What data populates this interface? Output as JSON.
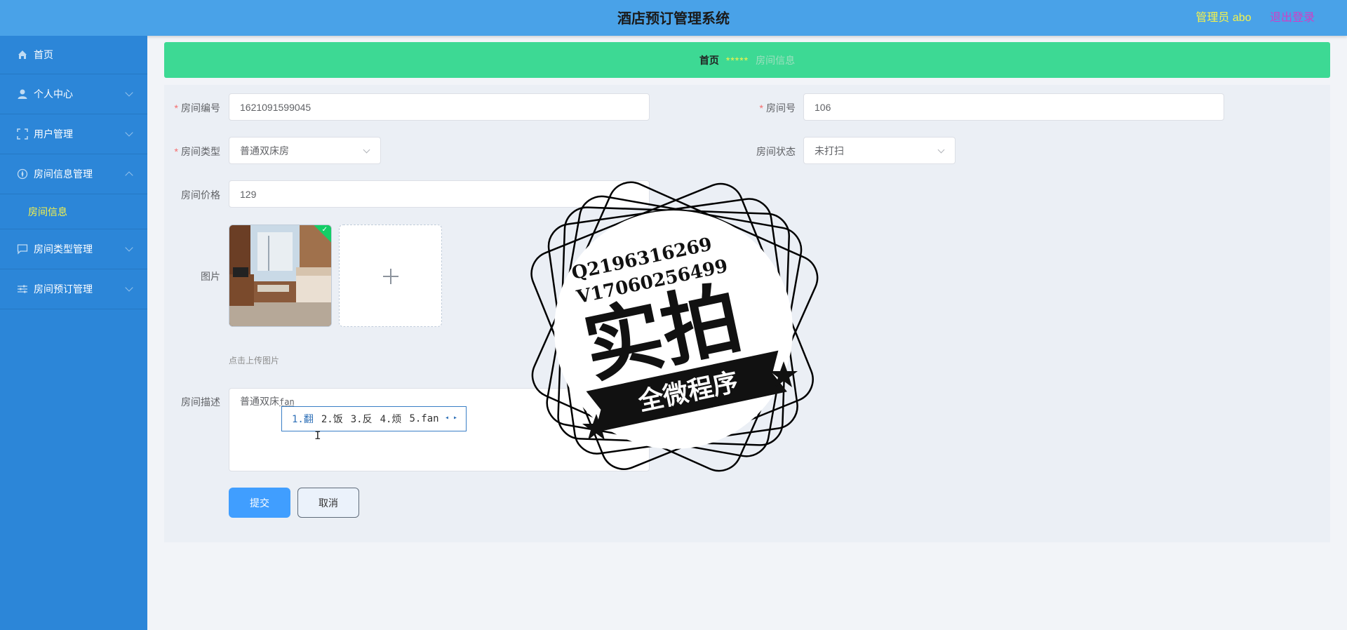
{
  "header": {
    "title": "酒店预订管理系统",
    "user_role": "管理员 abo",
    "logout": "退出登录"
  },
  "sidebar": {
    "items": [
      {
        "label": "首页",
        "icon": "home-icon"
      },
      {
        "label": "个人中心",
        "icon": "user-icon"
      },
      {
        "label": "用户管理",
        "icon": "users-frame-icon"
      },
      {
        "label": "房间信息管理",
        "icon": "compass-icon",
        "expanded": true,
        "children": [
          {
            "label": "房间信息"
          }
        ]
      },
      {
        "label": "房间类型管理",
        "icon": "chat-icon"
      },
      {
        "label": "房间预订管理",
        "icon": "sliders-icon"
      }
    ]
  },
  "breadcrumb": {
    "home": "首页",
    "separator": "*****",
    "current": "房间信息"
  },
  "form": {
    "room_id": {
      "label": "房间编号",
      "value": "1621091599045",
      "required": true
    },
    "room_no": {
      "label": "房间号",
      "value": "106",
      "required": true
    },
    "room_type": {
      "label": "房间类型",
      "value": "普通双床房",
      "required": true
    },
    "room_status": {
      "label": "房间状态",
      "value": "未打扫"
    },
    "room_price": {
      "label": "房间价格",
      "value": "129"
    },
    "image": {
      "label": "图片",
      "tip": "点击上传图片"
    },
    "description": {
      "label": "房间描述",
      "value": "普通双床",
      "ime_composition": "fan"
    },
    "submit": "提交",
    "cancel": "取消"
  },
  "ime": {
    "candidates": [
      "1.翻",
      "2.饭",
      "3.反",
      "4.烦",
      "5.fan"
    ],
    "selected_index": 0
  },
  "watermark": {
    "line1": "Q2196316269",
    "line2": "V17060256499",
    "main": "实拍",
    "banner": "全微程序"
  },
  "colors": {
    "header": "#49a2e8",
    "sidebar": "#2c86d8",
    "breadcrumb": "#3dd994",
    "accent": "#409eff",
    "highlight": "#f6f34a"
  }
}
